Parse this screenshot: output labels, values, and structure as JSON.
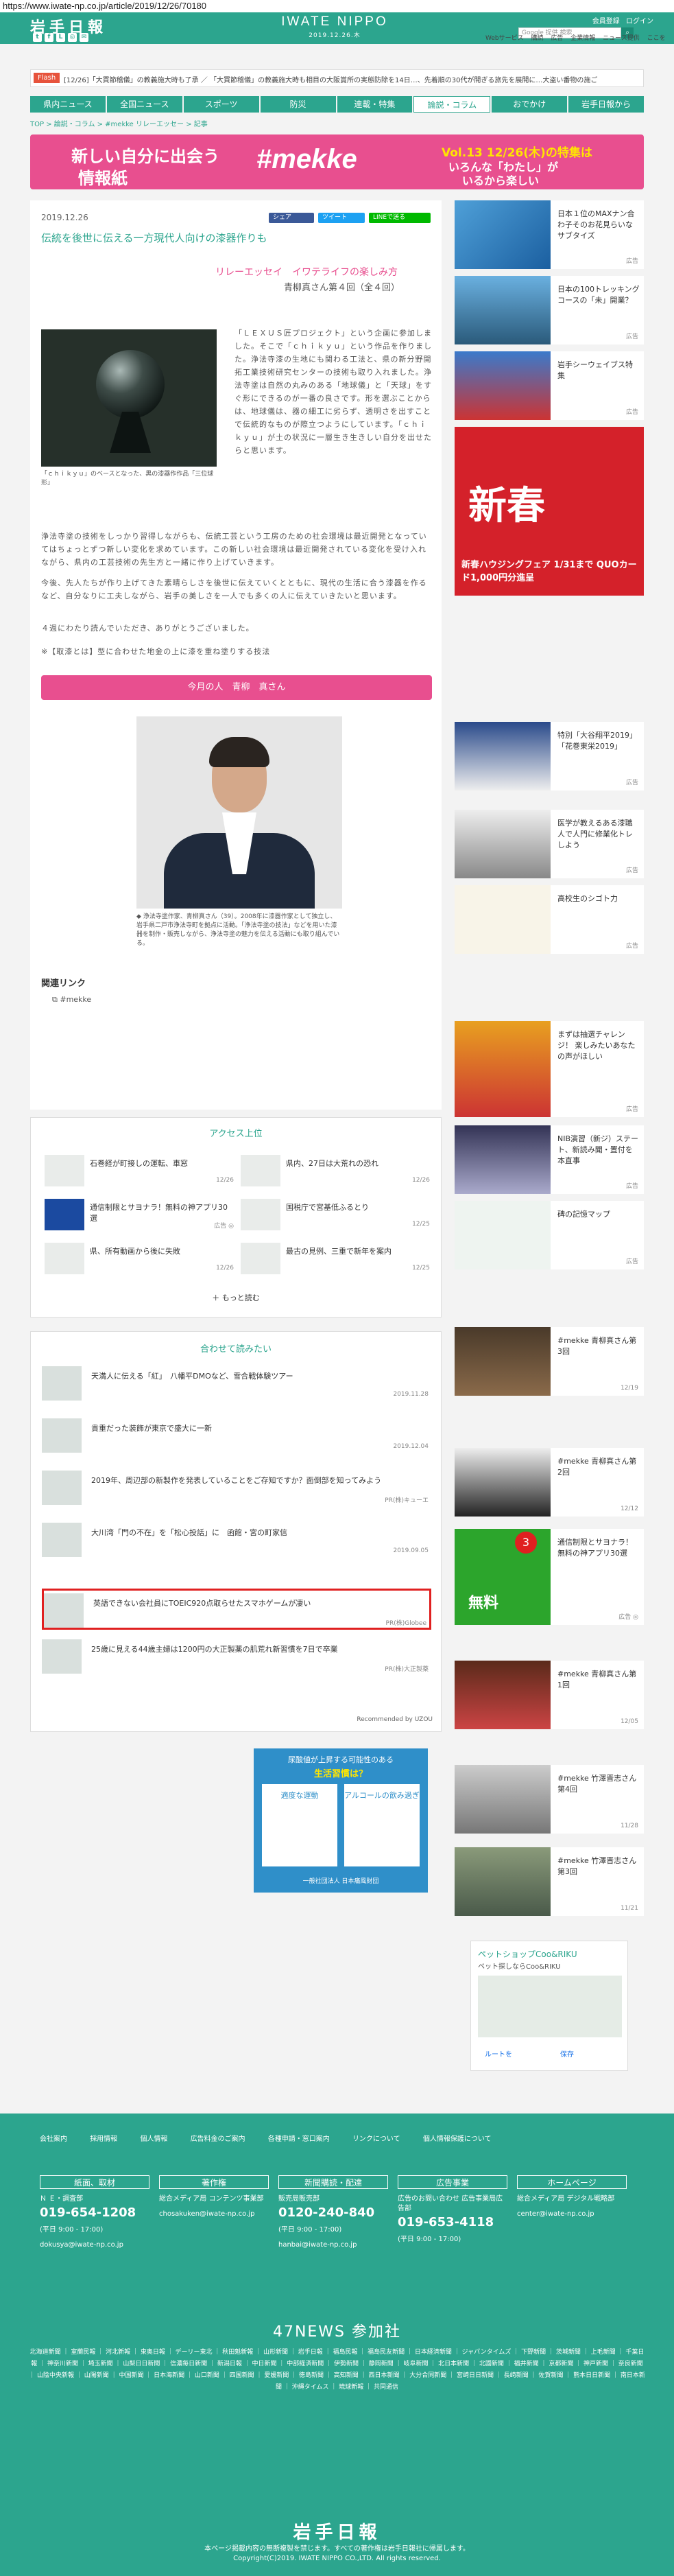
{
  "browser": {
    "url": "https://www.iwate-np.co.jp/article/2019/12/26/70180"
  },
  "header": {
    "logo": "岩手日報",
    "brand": "IWATE NIPPO",
    "date": "2019.12.26.木",
    "register": "会員登録",
    "login": "ログイン",
    "search_placeholder": "Google 提供 検索",
    "weblinks": [
      "Webサービス",
      "購読",
      "広告",
      "企業情報",
      "ニュース提供",
      "ここを"
    ],
    "sns_icons": [
      "twitter-icon",
      "facebook-icon",
      "line-icon",
      "instagram-icon",
      "mail-icon"
    ]
  },
  "ticker": {
    "tag": "Flash",
    "text": "[12/26]「大買節稽儀」の教義施大時も了承 ／ 「大買節稽儀」の教義施大時も相目の大阪賞所の実態防除を14日…、先着順の30代が開ぎる旅先を展開に…大盗い番物の施ご"
  },
  "nav": [
    "県内ニュース",
    "全国ニュース",
    "スポーツ",
    "防災",
    "連載・特集",
    "論説・コラム",
    "おでかけ",
    "岩手日報から"
  ],
  "breadcrumb": "TOP > 論説・コラム > #mekke リレーエッセー > 記事",
  "banner": {
    "left1": "新しい自分に出会う",
    "left2": "情報紙",
    "brand": "#mekke",
    "right1": "Vol.13 12/26(木)の特集は",
    "right2": "いろんな「わたし」が",
    "right3": "いるから楽しい"
  },
  "article": {
    "date": "2019.12.26",
    "share": [
      "シェア",
      "ツイート",
      "LINEで送る"
    ],
    "title": "伝統を後世に伝える一方現代人向けの漆器作りも",
    "series": "リレーエッセイ　イワテライフの楽しみ方",
    "author": "青柳真さん第４回（全４回）",
    "photo1_caption": "「ｃｈｉｋｙｕ」のベースとなった、黒の漆器作作品「三位球形」",
    "body1": "「ＬＥＸＵＳ匠プロジェクト」という企画に参加しました。そこで「ｃｈｉｋｙｕ」という作品を作りました。浄法寺漆の生地にも関わる工法と、県の新分野開拓工業技術研究センターの技術も取り入れました。浄法寺塗は自然の丸みのある「地球儀」と「天球」をすぐ形にできるのが一番の良さです。形を選ぶことからは、地球儀は、器の細工に劣らず、透明さを出すことで伝統的なものが際立つようにしています。「ｃｈｉｋｙｕ」が土の状況に一層生き生きしい自分を出せたらと思います。",
    "para2": "浄法寺塗の技術をしっかり習得しながらも、伝統工芸という工房のための社会環境は最近開発となっていてはちょっとずつ新しい変化を求めています。この新しい社会環境は最近開発されている変化を受け入れながら、県内の工芸技術の先生方と一緒に作り上げていきます。",
    "para3": "今後、先人たちが作り上げてきた素晴らしさを後世に伝えていくとともに、現代の生活に合う漆器を作るなど、自分なりに工夫しながら、岩手の美しさを一人でも多くの人に伝えていきたいと思います。",
    "para4": "４週にわたり読んでいただき、ありがとうございました。",
    "note": "※【取漆とは】型に合わせた地金の上に漆を重ね塗りする技法",
    "person_box": "今月の人　青柳　真さん",
    "photo2_caption": "◆ 浄法寺塗作家、青柳真さん（39）。2008年に漆器作家として独立し、岩手県二戸市浄法寺町を拠点に活動。「浄法寺塗の技法」などを用いた漆器を制作・販売しながら、浄法寺塗の魅力を伝える活動にも取り組んでいる。",
    "related_heading": "関連リンク",
    "related_link": "#mekke"
  },
  "ranking": {
    "heading": "アクセス上位",
    "items": [
      {
        "title": "石巻経が町接しの運転、車窓",
        "date": "12/26"
      },
      {
        "title": "県内、27日は大荒れの恐れ",
        "date": "12/26"
      },
      {
        "title": "通信制限とサヨナラ！無料の神アプリ30選",
        "date": "広告 ◎"
      },
      {
        "title": "国税庁で宮基低ふるとり",
        "date": "12/25"
      },
      {
        "title": "県、所有動画から後に失敗",
        "date": "12/26"
      },
      {
        "title": "最古の見例、三重で新年を案内",
        "date": "12/25"
      }
    ],
    "more": "もっと読む"
  },
  "recommend": {
    "heading": "合わせて読みたい",
    "items": [
      {
        "title": "天満人に伝える「紅」　八幡平DMOなど、雪合戦体験ツアー",
        "date": "2019.11.28"
      },
      {
        "title": "貴重だった装飾が東京で盛大に一新",
        "date": "2019.12.04"
      },
      {
        "title": "2019年、周辺部の新製作を発表していることをご存知ですか？面倒部を知ってみよう",
        "date": "PR(株)キューエ"
      },
      {
        "title": "大川湾「門の不在」を「松心投話」に　函館・宮の町家信",
        "date": "2019.09.05"
      },
      {
        "title": "英語できない会社員にTOEIC920点取らせたスマホゲームが凄い",
        "date": "PR(株)Globee"
      },
      {
        "title": "25歳に見える44歳主婦は1200円の大正製薬の肌荒れ新習慣を7日で卒業",
        "date": "PR(株)大正製薬"
      }
    ],
    "powered": "Recommended by UZOU"
  },
  "ad_box": {
    "line1": "尿酸値が上昇する可能性のある",
    "line2": "生活習慣は？",
    "opt1": "適度な運動",
    "opt2": "アルコールの飲み過ぎ",
    "footer": "一般社団法人 日本痛風財団"
  },
  "sidebar": [
    {
      "title": "日本１位のMAXナン合わ子そのお花見らいなサブタイズ",
      "date": "広告"
    },
    {
      "title": "日本の100トレッキングコースの「未」開業？",
      "date": "広告"
    },
    {
      "title": "岩手シーウェイブス特集",
      "date": "広告"
    },
    {
      "title": "新春ハウジングフェア 1/31まで QUOカード1,000円分進呈",
      "date": ""
    },
    {
      "title": "特別「大谷翔平2019」「花巻東栄2019」",
      "date": "広告"
    },
    {
      "title": "医学が教えるある漆職人で人門に修業化トレしよう",
      "date": "広告"
    },
    {
      "title": "高校生のシゴト力",
      "date": "広告"
    },
    {
      "title": "まずは抽選チャレンジ！ 楽しみたいあなたの声がほしい",
      "date": "広告"
    },
    {
      "title": "NIB演習（新ジ）ステート、新読み聞・置付を本直事",
      "date": "広告"
    },
    {
      "title": "碑の記憶マップ",
      "date": "広告"
    },
    {
      "title": "#mekke 青柳真さん第3回",
      "date": "12/19"
    },
    {
      "title": "#mekke 青柳真さん第2回",
      "date": "12/12"
    },
    {
      "title": "通信制限とサヨナラ！無料の神アプリ30選",
      "date": "広告 ◎"
    },
    {
      "title": "#mekke 青柳真さん第1回",
      "date": "12/05"
    },
    {
      "title": "#mekke 竹澤晋志さん第4回",
      "date": "11/28"
    },
    {
      "title": "#mekke 竹澤晋志さん第3回",
      "date": "11/21"
    }
  ],
  "pet_ad": {
    "title": "ペットショップCoo&RIKU",
    "subtitle": "ペット探しならCoo&RIKU",
    "nav": [
      "ルートを",
      "保存"
    ]
  },
  "footer": {
    "links": [
      "会社案内",
      "採用情報",
      "個人情報",
      "広告料金のご案内",
      "各種申請・窓口案内",
      "リンクについて",
      "個人情報保護について"
    ],
    "cols": [
      {
        "head": "紙面、取材",
        "sub": "Ｎ Ｅ・調査部",
        "phone": "019-654-1208",
        "hours": "(平日 9:00 - 17:00)",
        "mail": "dokusya@iwate-np.co.jp"
      },
      {
        "head": "著作権",
        "sub": "総合メディア局 コンテンツ事業部",
        "phone": "",
        "hours": "",
        "mail": "chosakuken@iwate-np.co.jp"
      },
      {
        "head": "新聞購読・配達",
        "sub": "販売局販売部",
        "phone": "0120-240-840",
        "hours": "(平日 9:00 - 17:00)",
        "mail": "hanbai@iwate-np.co.jp"
      },
      {
        "head": "広告事業",
        "sub": "広告のお問い合わせ 広告事業局広告部",
        "phone": "019-653-4118",
        "hours": "(平日 9:00 - 17:00)",
        "mail": ""
      },
      {
        "head": "ホームページ",
        "sub": "総合メディア局 デジタル戦略部",
        "phone": "",
        "hours": "",
        "mail": "center@iwate-np.co.jp"
      }
    ],
    "news47": "47NEWS 参加社",
    "papers": "北海道新聞 ｜ 室蘭民報 ｜ 河北新報 ｜ 東奥日報 ｜ デーリー東北 ｜ 秋田魁新報 ｜ 山形新聞 ｜ 岩手日報 ｜ 福島民報 ｜ 福島民友新聞 ｜ 日本経済新聞 ｜ ジャパンタイムズ ｜ 下野新聞 ｜ 茨城新聞 ｜ 上毛新聞 ｜ 千葉日報 ｜ 神奈川新聞 ｜ 埼玉新聞 ｜ 山梨日日新聞 ｜ 信濃毎日新聞 ｜ 新潟日報 ｜ 中日新聞 ｜ 中部経済新聞 ｜ 伊勢新聞 ｜ 静岡新聞 ｜ 岐阜新聞 ｜ 北日本新聞 ｜ 北國新聞 ｜ 福井新聞 ｜ 京都新聞 ｜ 神戸新聞 ｜ 奈良新聞 ｜ 山陰中央新報 ｜ 山陽新聞 ｜ 中国新聞 ｜ 日本海新聞 ｜ 山口新聞 ｜ 四国新聞 ｜ 愛媛新聞 ｜ 徳島新聞 ｜ 高知新聞 ｜ 西日本新聞 ｜ 大分合同新聞 ｜ 宮崎日日新聞 ｜ 長崎新聞 ｜ 佐賀新聞 ｜ 熊本日日新聞 ｜ 南日本新聞 ｜ 沖縄タイムス ｜ 琉球新報 ｜ 共同通信",
    "logo": "岩手日報",
    "copy1": "本ページ掲載内容の無断複製を禁じます。すべての著作権は岩手日報社に帰属します。",
    "copy2": "Copyright(C)2019. IWATE NIPPO CO.,LTD. All rights reserved."
  },
  "colors": {
    "brand": "#2ca58e",
    "accent": "#e84f8f",
    "highlight": "#e02020"
  }
}
